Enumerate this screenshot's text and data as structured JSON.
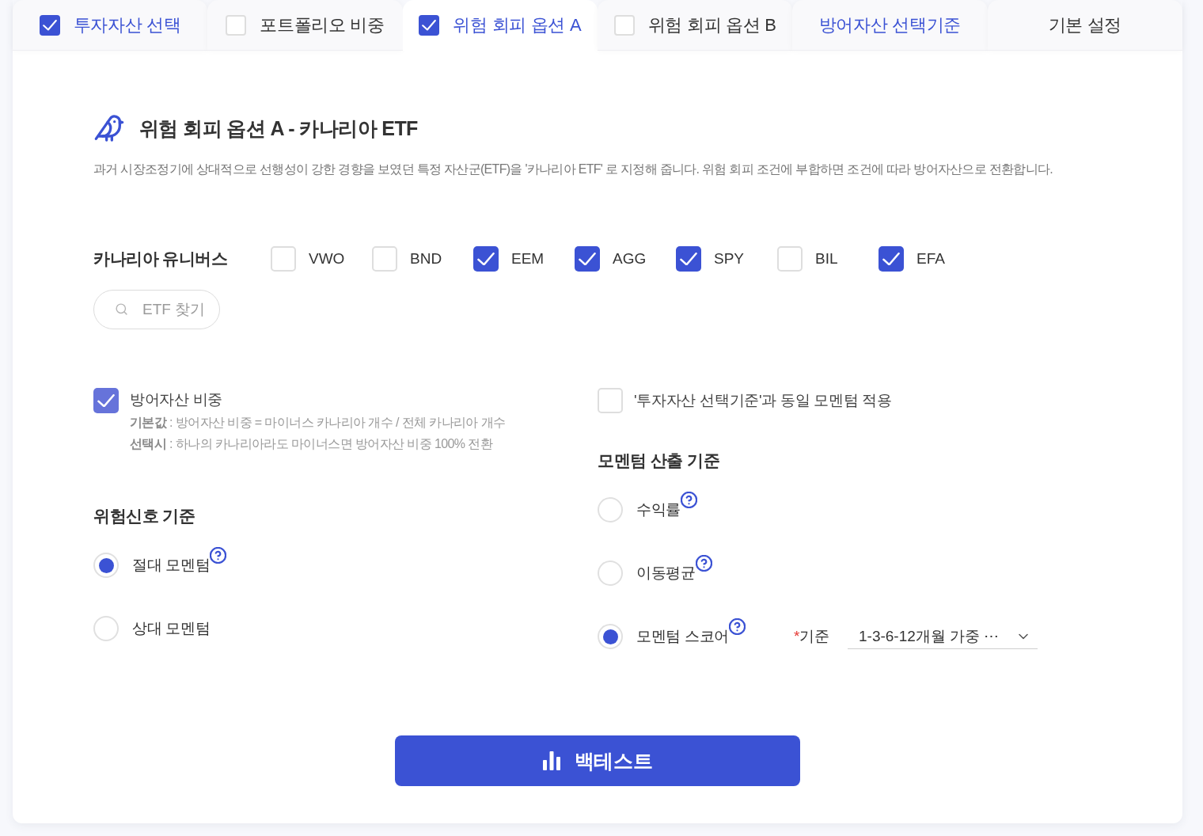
{
  "tabs": [
    {
      "label": "투자자산 선택",
      "kind": "checkbox",
      "checked": true,
      "highlighted": true,
      "selected": false
    },
    {
      "label": "포트폴리오 비중",
      "kind": "checkbox",
      "checked": false,
      "highlighted": false,
      "selected": false
    },
    {
      "label": "위험 회피 옵션 A",
      "kind": "checkbox",
      "checked": true,
      "highlighted": true,
      "selected": true
    },
    {
      "label": "위험 회피 옵션 B",
      "kind": "checkbox",
      "checked": false,
      "highlighted": false,
      "selected": false
    },
    {
      "label": "방어자산 선택기준",
      "kind": "plain",
      "highlighted": true,
      "selected": false
    },
    {
      "label": "기본 설정",
      "kind": "plain",
      "highlighted": false,
      "selected": false
    }
  ],
  "section": {
    "title": "위험 회피 옵션 A - 카나리아 ETF",
    "description": "과거 시장조정기에 상대적으로 선행성이 강한 경향을 보였던 특정 자산군(ETF)을 '카나리아 ETF' 로 지정해 줍니다. 위험 회피 조건에 부합하면 조건에 따라 방어자산으로 전환합니다."
  },
  "canary_universe": {
    "label": "카나리아 유니버스",
    "items": [
      {
        "label": "VWO",
        "checked": false
      },
      {
        "label": "BND",
        "checked": false
      },
      {
        "label": "EEM",
        "checked": true
      },
      {
        "label": "AGG",
        "checked": true
      },
      {
        "label": "SPY",
        "checked": true
      },
      {
        "label": "BIL",
        "checked": false
      },
      {
        "label": "EFA",
        "checked": true
      }
    ],
    "search": {
      "placeholder": "ETF 찾기"
    }
  },
  "defensive_weight": {
    "label": "방어자산 비중",
    "checked": true,
    "notes": [
      "**기본값** : 방어자산 비중 = 마이너스 카나리아 개수 / 전체 카나리아 개수",
      "**선택시** : 하나의 카나리아라도 마이너스면 방어자산 비중 100% 전환"
    ]
  },
  "risk_signal": {
    "title": "위험신호 기준",
    "options": [
      {
        "label": "절대 모멘텀",
        "help": true,
        "selected": true
      },
      {
        "label": "상대 모멘텀",
        "help": false,
        "selected": false
      }
    ]
  },
  "same_momentum": {
    "label": "'투자자산 선택기준'과 동일 모멘텀 적용",
    "checked": false
  },
  "momentum_basis": {
    "title": "모멘텀 산출 기준",
    "options": [
      {
        "label": "수익률",
        "help": true,
        "selected": false
      },
      {
        "label": "이동평균",
        "help": true,
        "selected": false
      },
      {
        "label": "모멘텀 스코어",
        "help": true,
        "selected": true,
        "criterion": {
          "required_mark": "*",
          "label": "기준",
          "value": "1-3-6-12개월 가중 ⋯"
        }
      }
    ]
  },
  "backtest_button": {
    "label": "백테스트"
  }
}
